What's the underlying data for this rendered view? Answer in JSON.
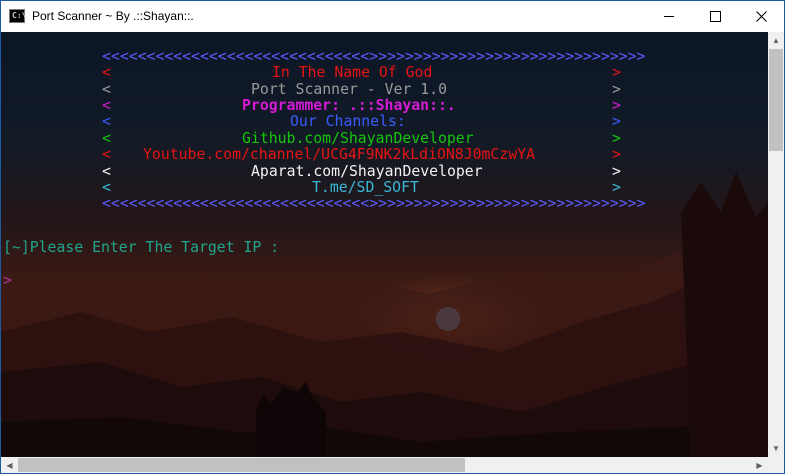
{
  "window": {
    "title": "Port Scanner ~ By .::Shayan::.",
    "icon_label": "C:\\",
    "controls": [
      "minimize-icon",
      "maximize-icon",
      "close-icon"
    ]
  },
  "banner": {
    "top_border": "<<<<<<<<<<<<<<<<<<<<<<<<<<<<<<>>>>>>>>>>>>>>>>>>>>>>>>>>>>>>>",
    "bottom_border": "<<<<<<<<<<<<<<<<<<<<<<<<<<<<<<>>>>>>>>>>>>>>>>>>>>>>>>>>>>>>>",
    "left_bracket": "<",
    "right_bracket": ">",
    "lines": [
      {
        "text": "In The Name Of God",
        "color": "#e81313"
      },
      {
        "text": "Port Scanner - Ver 1.0",
        "color": "#9a9a9a"
      },
      {
        "text": "Programmer: .::Shayan::.",
        "color": "#d61bd6"
      },
      {
        "text": "Our Channels:",
        "color": "#3b5bff"
      },
      {
        "text": "Github.com/ShayanDeveloper",
        "color": "#16c60c"
      },
      {
        "text": "Youtube.com/channel/UCG4F9NK2kLdiON8J0mCzwYA",
        "color": "#e81313"
      },
      {
        "text": "Aparat.com/ShayanDeveloper",
        "color": "#f2f2f2"
      },
      {
        "text": "T.me/SD_SOFT",
        "color": "#3ab7d6"
      }
    ]
  },
  "prompt": {
    "text": "[~]Please Enter The Target IP :",
    "caret": ">"
  },
  "colors": {
    "border": "#5b5bff",
    "prompt": "#1fa68c",
    "caret": "#b0359e"
  }
}
